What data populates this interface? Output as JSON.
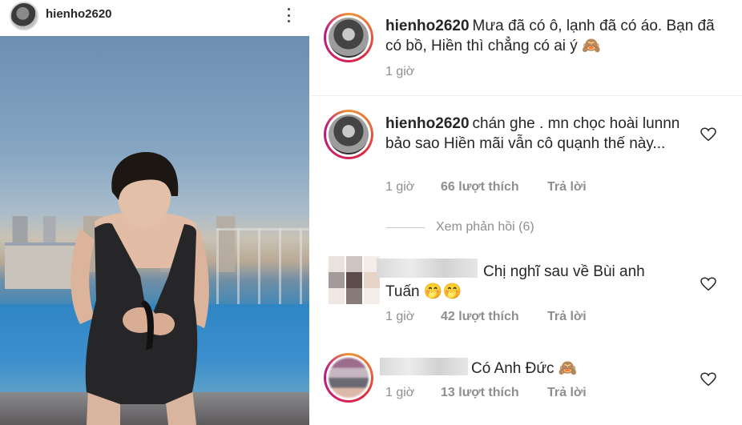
{
  "post": {
    "username": "hienho2620"
  },
  "comments": [
    {
      "username": "hienho2620",
      "text": "Mưa đã có ô, lạnh đã có áo. Bạn đã có bồ, Hiền thì chẳng có ai ý 🙈",
      "time": "1 giờ"
    },
    {
      "username": "hienho2620",
      "text": "chán ghe . mn chọc hoài lunnn bảo sao Hiền mãi vẫn cô quạnh thế này...",
      "time": "1 giờ",
      "likes": "66 lượt thích",
      "reply": "Trả lời",
      "view_replies": "Xem phản hồi (6)"
    },
    {
      "text": "Chị nghĩ sau về Bùi anh Tuấn 🤭🤭",
      "time": "1 giờ",
      "likes": "42 lượt thích",
      "reply": "Trả lời"
    },
    {
      "text": "Có Anh Đức 🙈",
      "time": "1 giờ",
      "likes": "13 lượt thích",
      "reply": "Trả lời"
    }
  ]
}
